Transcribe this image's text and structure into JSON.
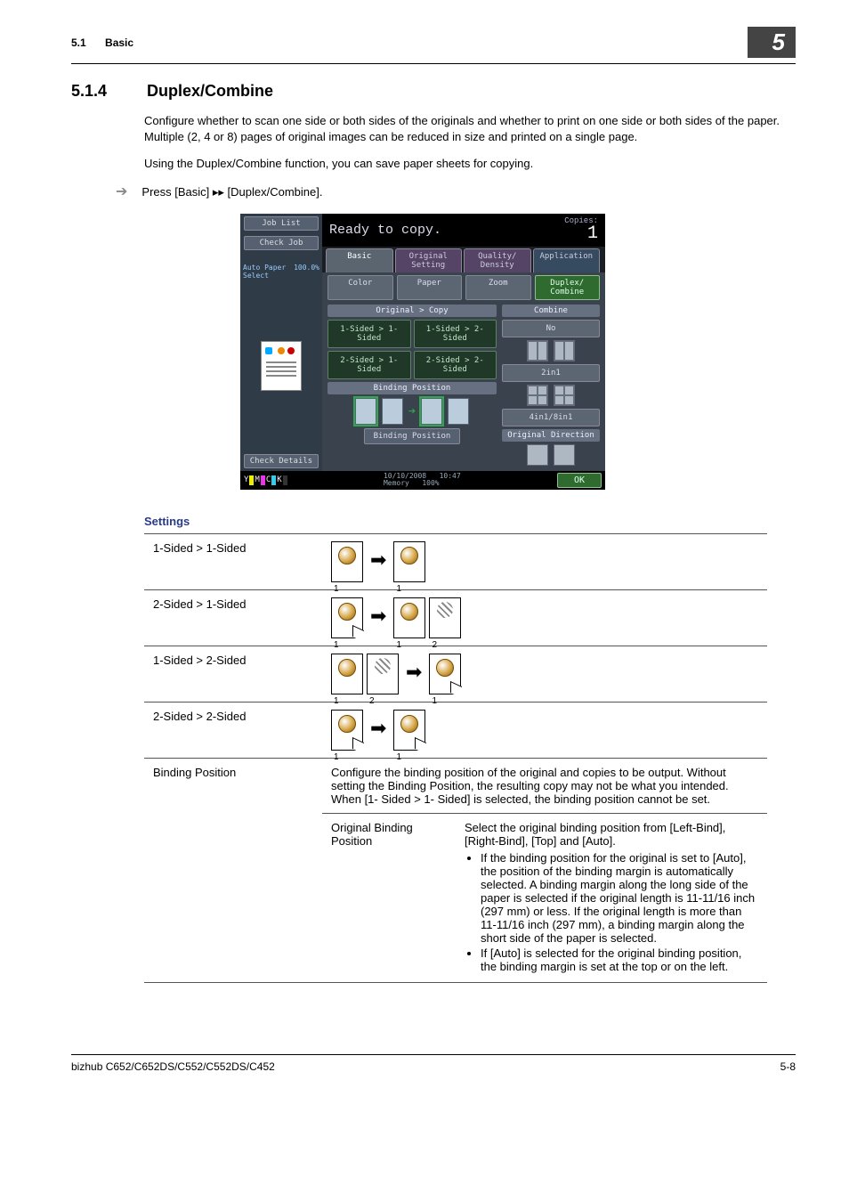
{
  "header": {
    "section_num": "5.1",
    "section_name": "Basic",
    "chapter": "5"
  },
  "section": {
    "number": "5.1.4",
    "title": "Duplex/Combine"
  },
  "para1": "Configure whether to scan one side or both sides of the originals and whether to print on one side or both sides of the paper. Multiple (2, 4 or 8) pages of original images can be reduced in size and printed on a single page.",
  "para2": "Using the Duplex/Combine function, you can save paper sheets for copying.",
  "step1": "Press [Basic] ▸▸ [Duplex/Combine].",
  "panel": {
    "left": {
      "job_list": "Job List",
      "check_job": "Check Job",
      "auto_paper": "Auto Paper Select",
      "zoom_pct": "100.0%",
      "check_details": "Check Details"
    },
    "ready": "Ready to copy.",
    "copies_label": "Copies:",
    "copies_value": "1",
    "tabs": {
      "basic": "Basic",
      "original_setting": "Original Setting",
      "quality_density": "Quality/ Density",
      "application": "Application"
    },
    "subtabs": {
      "color": "Color",
      "paper": "Paper",
      "zoom": "Zoom",
      "duplex_combine": "Duplex/ Combine"
    },
    "oc": {
      "title": "Original > Copy",
      "b1": "1-Sided > 1-Sided",
      "b2": "1-Sided > 2-Sided",
      "b3": "2-Sided > 1-Sided",
      "b4": "2-Sided > 2-Sided",
      "binding_title": "Binding Position",
      "binding_btn": "Binding Position"
    },
    "combine": {
      "title": "Combine",
      "no": "No",
      "two": "2in1",
      "four": "4in1/8in1",
      "orig_dir": "Original Direction"
    },
    "toners": {
      "y": "Y",
      "m": "M",
      "c": "C",
      "k": "K"
    },
    "status_date": "10/10/2008",
    "status_time": "10:47",
    "status_mem_label": "Memory",
    "status_mem_val": "100%",
    "ok": "OK"
  },
  "settings": {
    "heading": "Settings",
    "row1": "1-Sided > 1-Sided",
    "row2": "2-Sided > 1-Sided",
    "row3": "1-Sided > 2-Sided",
    "row4": "2-Sided > 2-Sided",
    "row5": "Binding Position",
    "row5_desc": "Configure the binding position of the original and copies to be output. Without setting the Binding Position, the resulting copy may not be what you intended.\nWhen [1- Sided > 1- Sided] is selected, the binding position cannot be set.",
    "row5_sub_label": "Original Binding Position",
    "row5_sub_intro": "Select the original binding position from [Left-Bind], [Right-Bind], [Top] and [Auto].",
    "row5_b1": "If the binding position for the original is set to [Auto], the position of the binding margin is automatically selected. A binding margin along the long side of the paper is selected if the original length is 11-11/16 inch (297 mm) or less. If the original length is more than 11-11/16 inch (297 mm), a binding margin along the short side of the paper is selected.",
    "row5_b2": "If [Auto] is selected for the original binding position, the binding margin is set at the top or on the left."
  },
  "footer": {
    "model": "bizhub C652/C652DS/C552/C552DS/C452",
    "page": "5-8"
  }
}
